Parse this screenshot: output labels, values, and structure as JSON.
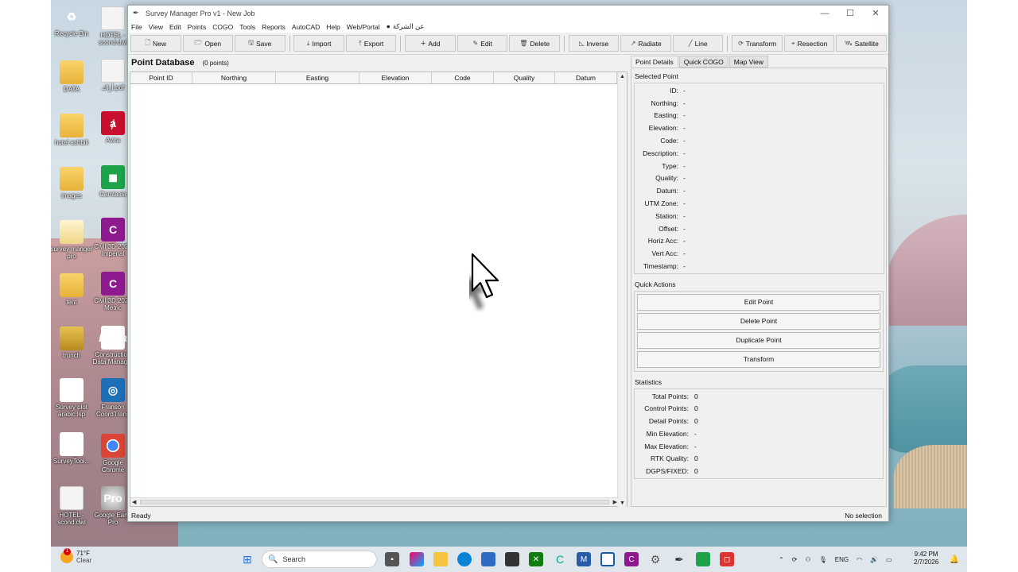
{
  "desktop": {
    "icons_col1": [
      "Recycle Bin",
      "DATA",
      "hotel ashbili",
      "images",
      "survey manger pro",
      "tent",
      "trunch",
      "Survey plot arabic.lsp",
      "SurveyTool...",
      "HOTEL - scond.dwl"
    ],
    "icons_col2": [
      "HOTEL - scond.dwl",
      "أزاك.pdf",
      "Avira",
      "Camtasia",
      "Civil 3D 2026 Imperial",
      "Civil 3D 2026 Metric",
      "Construction Data Manager",
      "Franson CoordTrans",
      "Google Chrome",
      "Google Earth Pro"
    ]
  },
  "window": {
    "title": "Survey Manager Pro v1 - New Job",
    "minimize": "—",
    "maximize": "☐",
    "close": "✕"
  },
  "menu": [
    "File",
    "View",
    "Edit",
    "Points",
    "COGO",
    "Tools",
    "Reports",
    "AutoCAD",
    "Help",
    "Web/Portal",
    "عن الشركة"
  ],
  "toolbar": {
    "new": "New",
    "open": "Open",
    "save": "Save",
    "import": "Import",
    "export": "Export",
    "add": "Add",
    "edit": "Edit",
    "delete": "Delete",
    "inverse": "Inverse",
    "radiate": "Radiate",
    "line": "Line",
    "transform": "Transform",
    "resection": "Resection",
    "satellite": "Satellite"
  },
  "database": {
    "title": "Point Database",
    "count": "(0 points)",
    "columns": [
      "Point ID",
      "Northing",
      "Easting",
      "Elevation",
      "Code",
      "Quality",
      "Datum"
    ]
  },
  "tabs": [
    "Point Details",
    "Quick COGO",
    "Map View"
  ],
  "selected_point": {
    "title": "Selected Point",
    "fields": [
      {
        "label": "ID:",
        "value": "-"
      },
      {
        "label": "Northing:",
        "value": "-"
      },
      {
        "label": "Easting:",
        "value": "-"
      },
      {
        "label": "Elevation:",
        "value": "-"
      },
      {
        "label": "Code:",
        "value": "-"
      },
      {
        "label": "Description:",
        "value": "-"
      },
      {
        "label": "Type:",
        "value": "-"
      },
      {
        "label": "Quality:",
        "value": "-"
      },
      {
        "label": "Datum:",
        "value": "-"
      },
      {
        "label": "UTM Zone:",
        "value": "-"
      },
      {
        "label": "Station:",
        "value": "-"
      },
      {
        "label": "Offset:",
        "value": "-"
      },
      {
        "label": "Horiz Acc:",
        "value": "-"
      },
      {
        "label": "Vert Acc:",
        "value": "-"
      },
      {
        "label": "Timestamp:",
        "value": "-"
      }
    ]
  },
  "quick_actions": {
    "title": "Quick Actions",
    "buttons": [
      "Edit Point",
      "Delete Point",
      "Duplicate Point",
      "Transform"
    ]
  },
  "statistics": {
    "title": "Statistics",
    "fields": [
      {
        "label": "Total Points:",
        "value": "0"
      },
      {
        "label": "Control Points:",
        "value": "0"
      },
      {
        "label": "Detail Points:",
        "value": "0"
      },
      {
        "label": "Min Elevation:",
        "value": "-"
      },
      {
        "label": "Max Elevation:",
        "value": "-"
      },
      {
        "label": "RTK Quality:",
        "value": "0"
      },
      {
        "label": "DGPS/FIXED:",
        "value": "0"
      }
    ]
  },
  "status": {
    "left": "Ready",
    "right": "No selection"
  },
  "taskbar": {
    "temp": "71°F",
    "weather": "Clear",
    "weather_badge": "1",
    "search": "Search",
    "lang": "ENG",
    "time": "9:42 PM",
    "date": "2/7/2026"
  }
}
